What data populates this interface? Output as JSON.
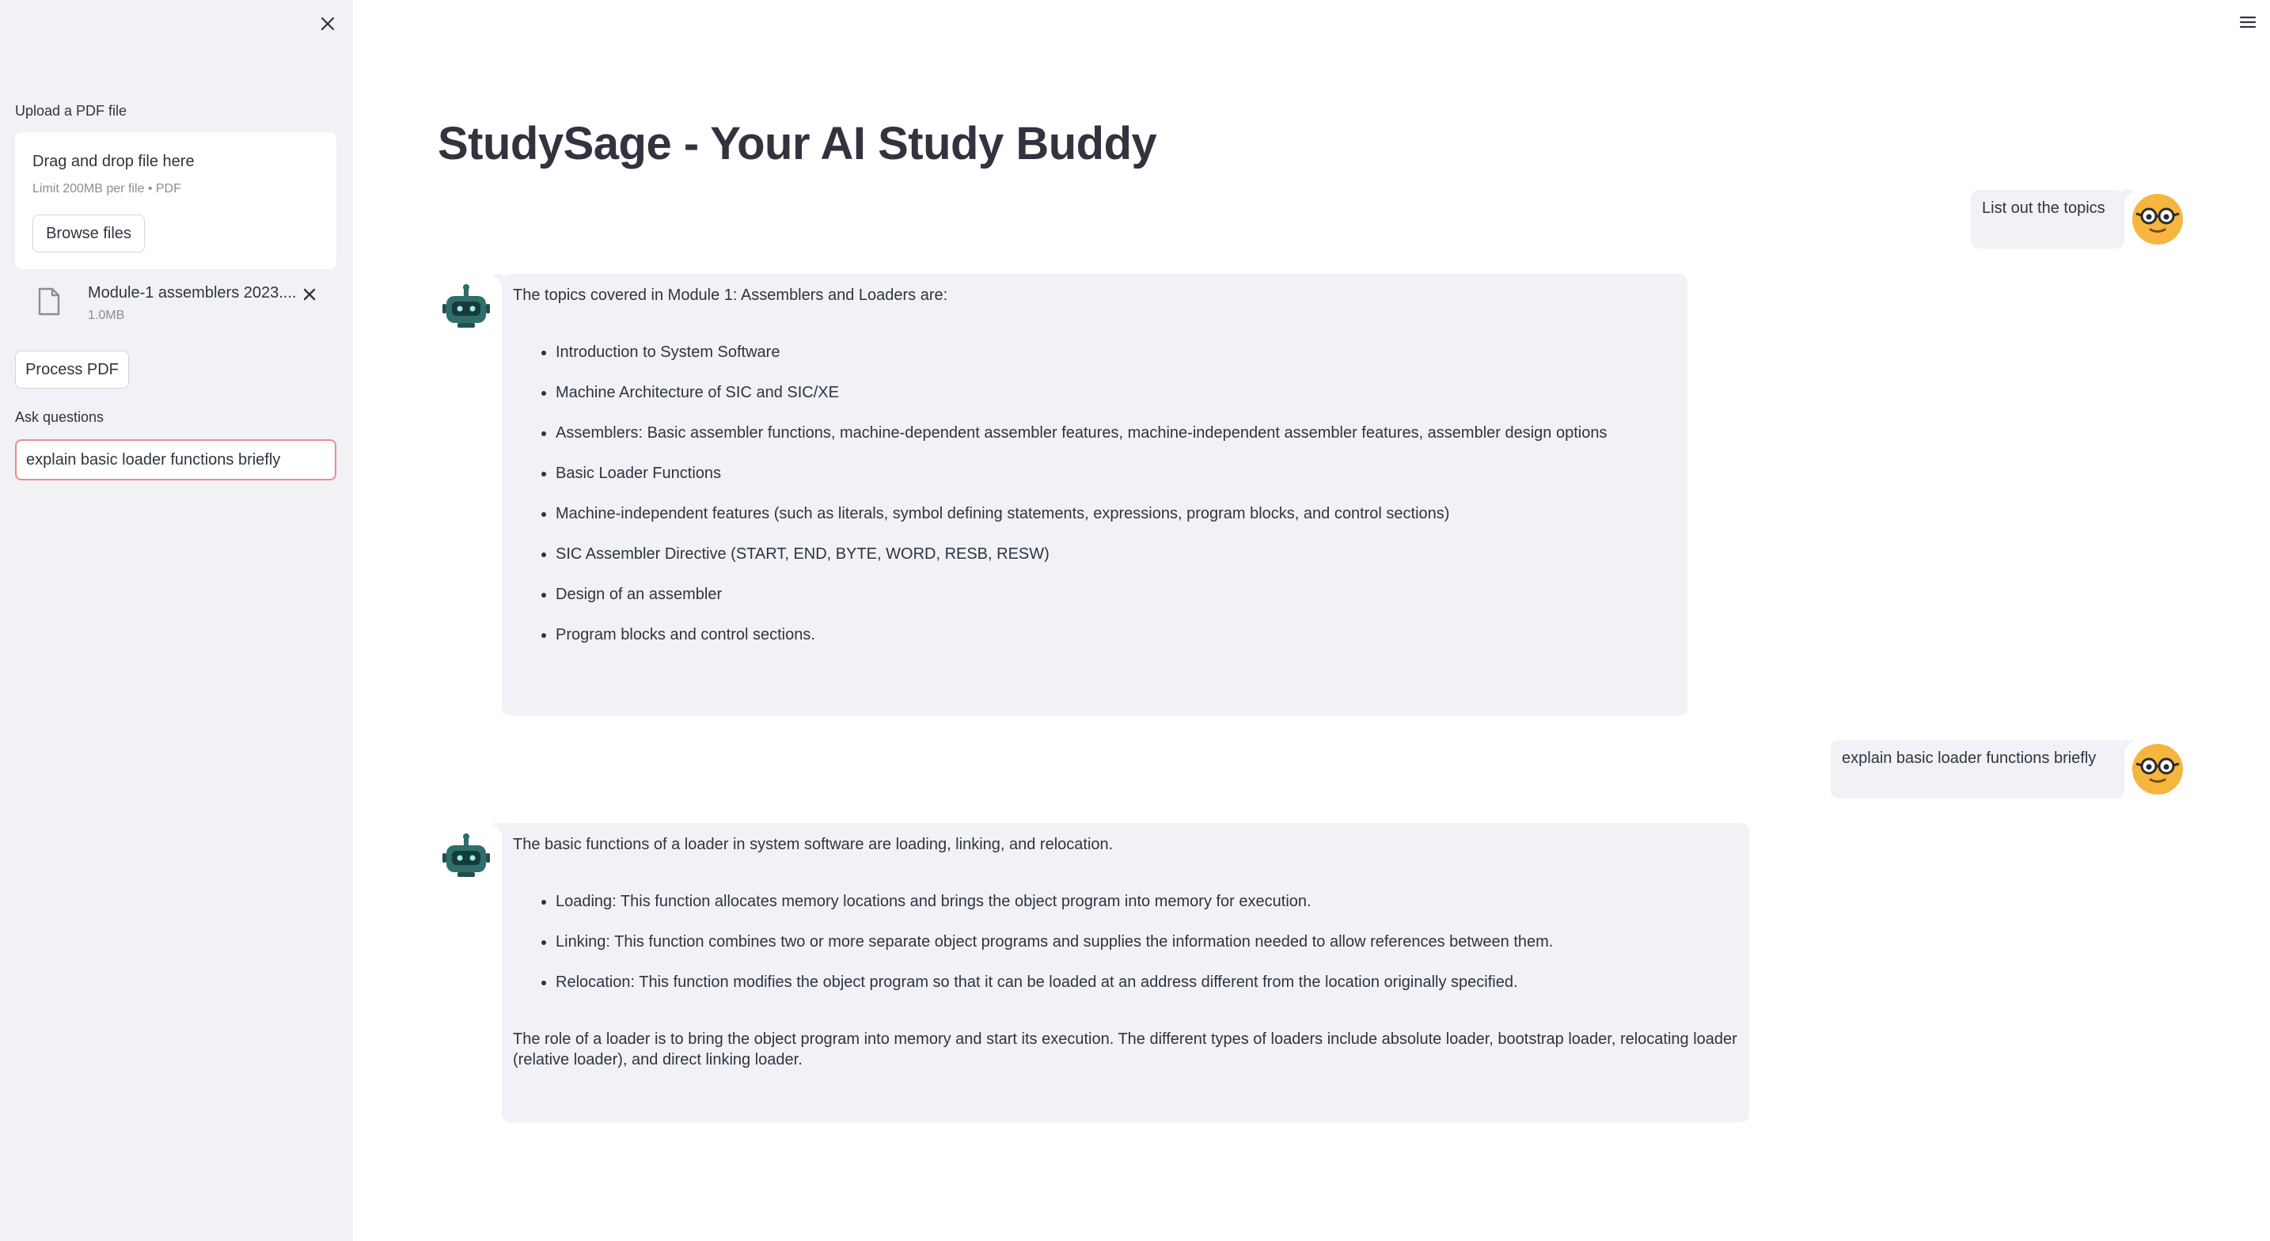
{
  "sidebar": {
    "upload_label": "Upload a PDF file",
    "dropzone": {
      "title": "Drag and drop file here",
      "subtitle": "Limit 200MB per file • PDF",
      "browse_label": "Browse files"
    },
    "file": {
      "name": "Module-1 assemblers 2023....",
      "size": "1.0MB"
    },
    "process_label": "Process PDF",
    "ask_label": "Ask questions",
    "ask_value": "explain basic loader functions briefly"
  },
  "main": {
    "title": "StudySage - Your AI Study Buddy",
    "messages": [
      {
        "role": "user",
        "text": "List out the topics"
      },
      {
        "role": "assistant",
        "intro": "The topics covered in Module 1: Assemblers and Loaders are:",
        "bullets": [
          "Introduction to System Software",
          "Machine Architecture of SIC and SIC/XE",
          "Assemblers: Basic assembler functions, machine-dependent assembler features, machine-independent assembler features, assembler design options",
          "Basic Loader Functions",
          "Machine-independent features (such as literals, symbol defining statements, expressions, program blocks, and control sections)",
          "SIC Assembler Directive (START, END, BYTE, WORD, RESB, RESW)",
          "Design of an assembler",
          "Program blocks and control sections."
        ]
      },
      {
        "role": "user",
        "text": "explain basic loader functions briefly"
      },
      {
        "role": "assistant",
        "intro": "The basic functions of a loader in system software are loading, linking, and relocation.",
        "bullets": [
          "Loading: This function allocates memory locations and brings the object program into memory for execution.",
          "Linking: This function combines two or more separate object programs and supplies the information needed to allow references between them.",
          "Relocation: This function modifies the object program so that it can be loaded at an address different from the location originally specified."
        ],
        "outro": "The role of a loader is to bring the object program into memory and start its execution. The different types of loaders include absolute loader, bootstrap loader, relocating loader (relative loader), and direct linking loader."
      }
    ]
  },
  "colors": {
    "sidebar_bg": "#f0f2f6",
    "bubble_bg": "#f0f2f6",
    "text": "#31333f",
    "focus_border": "#f08a8a",
    "user_avatar": "#f5b53f",
    "bot_avatar": "#2f6e6a"
  },
  "icons": {
    "sidebar_close": "close-icon",
    "file": "file-icon",
    "file_remove": "close-icon",
    "menu": "hamburger-menu-icon",
    "user_avatar": "nerd-face-icon",
    "bot_avatar": "robot-icon"
  }
}
